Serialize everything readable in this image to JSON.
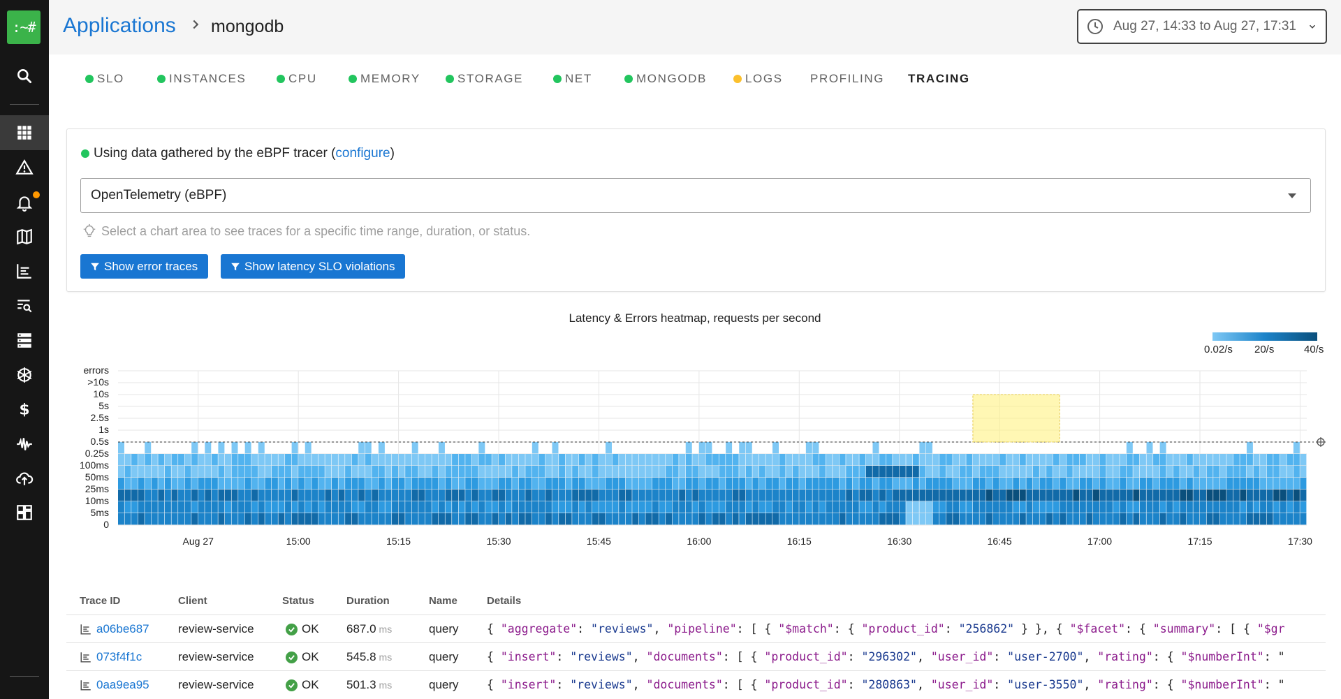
{
  "sidebar": {
    "logo": ":~#",
    "items": [
      "search-icon",
      "applications-icon",
      "incidents-icon",
      "alerts-icon",
      "service-map-icon",
      "dashboards-icon",
      "logs-search-icon",
      "nodes-icon",
      "kubernetes-icon",
      "costs-icon",
      "anomalies-icon",
      "cloud-icon",
      "overview-icon"
    ]
  },
  "header": {
    "breadcrumb_app": "Applications",
    "breadcrumb_current": "mongodb",
    "time_range": "Aug 27, 14:33 to Aug 27, 17:31"
  },
  "tabs": [
    {
      "label": "SLO",
      "status": "#22c55e"
    },
    {
      "label": "INSTANCES",
      "status": "#22c55e"
    },
    {
      "label": "CPU",
      "status": "#22c55e"
    },
    {
      "label": "MEMORY",
      "status": "#22c55e"
    },
    {
      "label": "STORAGE",
      "status": "#22c55e"
    },
    {
      "label": "NET",
      "status": "#22c55e"
    },
    {
      "label": "MONGODB",
      "status": "#22c55e"
    },
    {
      "label": "LOGS",
      "status": "#fbc02d"
    },
    {
      "label": "PROFILING",
      "status": ""
    },
    {
      "label": "TRACING",
      "status": ""
    }
  ],
  "tracing": {
    "info_prefix": "Using data gathered by the eBPF tracer (",
    "info_link": "configure",
    "info_suffix": ")",
    "source_select": "OpenTelemetry (eBPF)",
    "hint": "Select a chart area to see traces for a specific time range, duration, or status.",
    "btn_errors": "Show error traces",
    "btn_slo": "Show latency SLO violations"
  },
  "chart_data": {
    "type": "heatmap",
    "title": "Latency & Errors heatmap, requests per second",
    "legend": [
      "0.02/s",
      "20/s",
      "40/s"
    ],
    "legend_colors": [
      "#7ec8f5",
      "#1c83c9",
      "#0a4f7c"
    ],
    "y_labels": [
      "errors",
      ">10s",
      "10s",
      "5s",
      "2.5s",
      "1s",
      "0.5s",
      "0.25s",
      "100ms",
      "50ms",
      "25ms",
      "10ms",
      "5ms",
      "0"
    ],
    "x_labels": [
      "Aug 27",
      "15:00",
      "15:15",
      "15:30",
      "15:45",
      "16:00",
      "16:15",
      "16:30",
      "16:45",
      "17:00",
      "17:15",
      "17:30"
    ],
    "slo_threshold": "0.5s",
    "grid": true,
    "selection": {
      "from": "16:41",
      "to": "16:54",
      "from_latency": "10s",
      "to_latency": "0.5s"
    }
  },
  "table": {
    "headers": [
      "Trace ID",
      "Client",
      "Status",
      "Duration",
      "Name",
      "Details"
    ],
    "rows": [
      {
        "id": "a06be687",
        "client": "review-service",
        "status": "OK",
        "duration": "687.0",
        "unit": "ms",
        "name": "query",
        "details": [
          [
            "{ ",
            "p"
          ],
          [
            "\"aggregate\"",
            "k"
          ],
          [
            ": ",
            "p"
          ],
          [
            "\"reviews\"",
            "v"
          ],
          [
            ", ",
            "p"
          ],
          [
            "\"pipeline\"",
            "k"
          ],
          [
            ": [ { ",
            "p"
          ],
          [
            "\"$match\"",
            "k"
          ],
          [
            ": { ",
            "p"
          ],
          [
            "\"product_id\"",
            "k"
          ],
          [
            ": ",
            "p"
          ],
          [
            "\"256862\"",
            "v"
          ],
          [
            " } }, { ",
            "p"
          ],
          [
            "\"$facet\"",
            "k"
          ],
          [
            ": { ",
            "p"
          ],
          [
            "\"summary\"",
            "k"
          ],
          [
            ": [ { ",
            "p"
          ],
          [
            "\"$gr",
            "k"
          ]
        ]
      },
      {
        "id": "073f4f1c",
        "client": "review-service",
        "status": "OK",
        "duration": "545.8",
        "unit": "ms",
        "name": "query",
        "details": [
          [
            "{ ",
            "p"
          ],
          [
            "\"insert\"",
            "k"
          ],
          [
            ": ",
            "p"
          ],
          [
            "\"reviews\"",
            "v"
          ],
          [
            ", ",
            "p"
          ],
          [
            "\"documents\"",
            "k"
          ],
          [
            ": [ { ",
            "p"
          ],
          [
            "\"product_id\"",
            "k"
          ],
          [
            ": ",
            "p"
          ],
          [
            "\"296302\"",
            "v"
          ],
          [
            ", ",
            "p"
          ],
          [
            "\"user_id\"",
            "k"
          ],
          [
            ": ",
            "p"
          ],
          [
            "\"user-2700\"",
            "v"
          ],
          [
            ", ",
            "p"
          ],
          [
            "\"rating\"",
            "k"
          ],
          [
            ": { ",
            "p"
          ],
          [
            "\"$numberInt\"",
            "k"
          ],
          [
            ": \"",
            "p"
          ]
        ]
      },
      {
        "id": "0aa9ea95",
        "client": "review-service",
        "status": "OK",
        "duration": "501.3",
        "unit": "ms",
        "name": "query",
        "details": [
          [
            "{ ",
            "p"
          ],
          [
            "\"insert\"",
            "k"
          ],
          [
            ": ",
            "p"
          ],
          [
            "\"reviews\"",
            "v"
          ],
          [
            ", ",
            "p"
          ],
          [
            "\"documents\"",
            "k"
          ],
          [
            ": [ { ",
            "p"
          ],
          [
            "\"product_id\"",
            "k"
          ],
          [
            ": ",
            "p"
          ],
          [
            "\"280863\"",
            "v"
          ],
          [
            ", ",
            "p"
          ],
          [
            "\"user_id\"",
            "k"
          ],
          [
            ": ",
            "p"
          ],
          [
            "\"user-3550\"",
            "v"
          ],
          [
            ", ",
            "p"
          ],
          [
            "\"rating\"",
            "k"
          ],
          [
            ": { ",
            "p"
          ],
          [
            "\"$numberInt\"",
            "k"
          ],
          [
            ": \"",
            "p"
          ]
        ]
      }
    ]
  }
}
